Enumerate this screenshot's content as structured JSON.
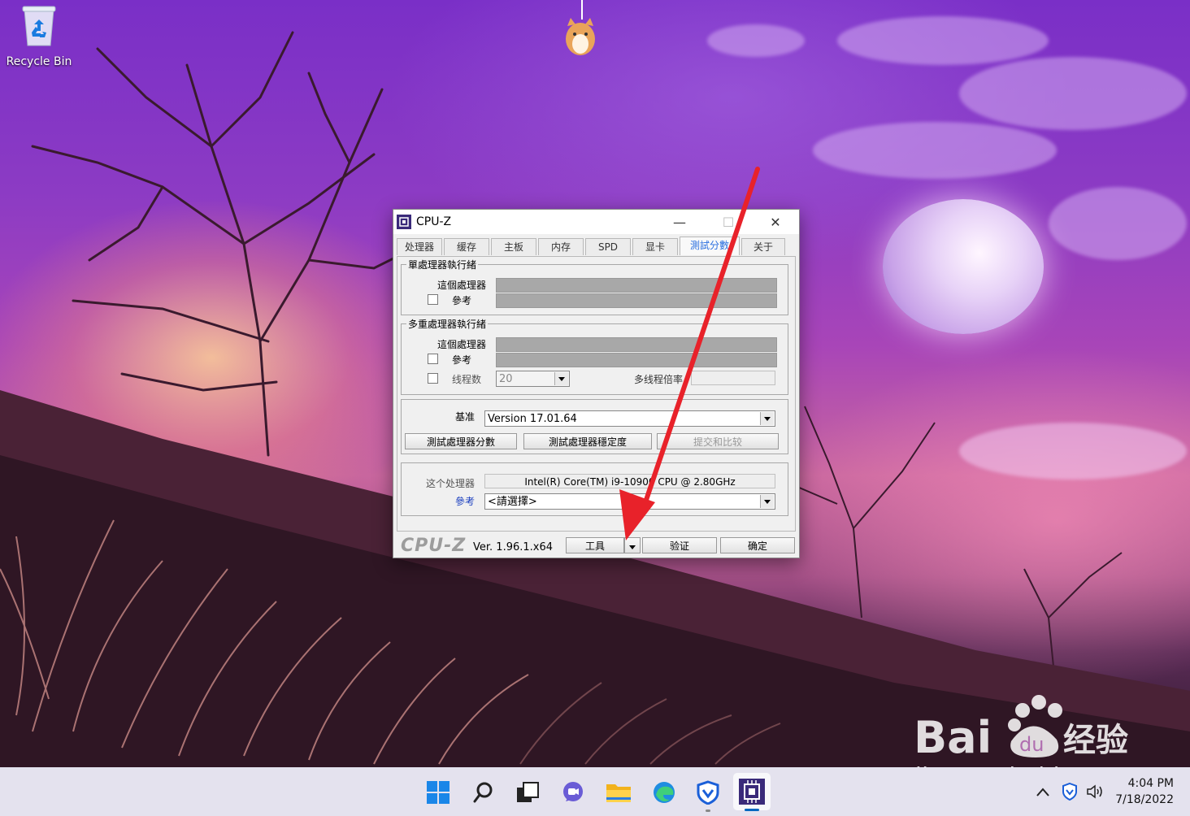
{
  "desktop": {
    "recycle_bin_label": "Recycle Bin"
  },
  "window": {
    "title": "CPU-Z",
    "minimize_glyph": "—",
    "maximize_glyph": "☐",
    "close_glyph": "✕",
    "tabs": [
      {
        "label": "处理器",
        "active": false
      },
      {
        "label": "缓存",
        "active": false
      },
      {
        "label": "主板",
        "active": false
      },
      {
        "label": "内存",
        "active": false
      },
      {
        "label": "SPD",
        "active": false
      },
      {
        "label": "显卡",
        "active": false
      },
      {
        "label": "測試分數",
        "active": true
      },
      {
        "label": "关于",
        "active": false
      }
    ],
    "single": {
      "title": "單處理器執行緒",
      "this_processor": "這個處理器",
      "reference": "參考"
    },
    "multi": {
      "title": "多重處理器執行緒",
      "this_processor": "這個處理器",
      "reference": "參考",
      "threads_label": "线程数",
      "threads_value": "20",
      "multi_ratio_label": "多线程倍率"
    },
    "benchmark": {
      "label": "基准",
      "version": "Version 17.01.64",
      "bench_button": "測試處理器分數",
      "stress_button": "測試處理器穩定度",
      "submit_button": "提交和比较"
    },
    "compare": {
      "this_label": "这个处理器",
      "this_value": "Intel(R) Core(TM) i9-10900 CPU @ 2.80GHz",
      "ref_label": "參考",
      "ref_value": "<請選擇>"
    },
    "footer": {
      "logo": "CPU-Z",
      "version": "Ver. 1.96.1.x64",
      "tools_button": "工具",
      "validate_button": "验证",
      "ok_button": "确定"
    }
  },
  "watermark": {
    "url": "jingyan.baidu.com"
  },
  "taskbar": {
    "icons": [
      "windows-start-icon",
      "search-icon",
      "task-view-icon",
      "chat-icon",
      "file-explorer-icon",
      "edge-icon",
      "security-shield-icon",
      "cpu-z-icon"
    ],
    "time": "4:04 PM",
    "date": "7/18/2022"
  },
  "colors": {
    "active_tab": "#2a6fe0",
    "annotation_arrow": "#e8222a",
    "taskbar": "#e4e2ee"
  }
}
